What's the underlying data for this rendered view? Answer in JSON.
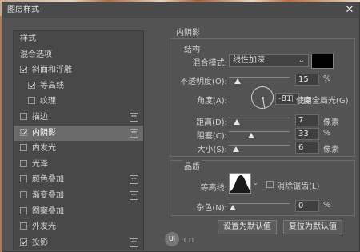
{
  "window": {
    "title": "图层样式",
    "close_glyph": "✕"
  },
  "left_list": {
    "header": "样式",
    "items": [
      {
        "label": "混合选项",
        "checkbox": false,
        "checked": false,
        "plus": false,
        "indent": false
      },
      {
        "label": "斜面和浮雕",
        "checkbox": true,
        "checked": true,
        "plus": false,
        "indent": false
      },
      {
        "label": "等高线",
        "checkbox": true,
        "checked": true,
        "plus": false,
        "indent": true
      },
      {
        "label": "纹理",
        "checkbox": true,
        "checked": false,
        "plus": false,
        "indent": true
      },
      {
        "label": "描边",
        "checkbox": true,
        "checked": false,
        "plus": true,
        "indent": false
      },
      {
        "label": "内阴影",
        "checkbox": true,
        "checked": true,
        "plus": true,
        "indent": false,
        "selected": true
      },
      {
        "label": "内发光",
        "checkbox": true,
        "checked": false,
        "plus": false,
        "indent": false
      },
      {
        "label": "光泽",
        "checkbox": true,
        "checked": false,
        "plus": false,
        "indent": false
      },
      {
        "label": "颜色叠加",
        "checkbox": true,
        "checked": false,
        "plus": true,
        "indent": false
      },
      {
        "label": "渐变叠加",
        "checkbox": true,
        "checked": false,
        "plus": true,
        "indent": false
      },
      {
        "label": "图案叠加",
        "checkbox": true,
        "checked": false,
        "plus": false,
        "indent": false
      },
      {
        "label": "外发光",
        "checkbox": true,
        "checked": false,
        "plus": false,
        "indent": false
      },
      {
        "label": "投影",
        "checkbox": true,
        "checked": true,
        "plus": true,
        "indent": false
      }
    ]
  },
  "panel": {
    "title": "内阴影",
    "structure": {
      "label": "结构",
      "blend_mode_label": "混合模式:",
      "blend_mode_value": "线性加深",
      "color": "#000000",
      "opacity_label": "不透明度(O):",
      "opacity_value": "15",
      "opacity_fraction": 0.15,
      "opacity_unit": "%",
      "angle_label": "角度(A):",
      "angle_value": "-81",
      "angle_unit": "度",
      "global_light_label": "使用全局光(G)",
      "global_light_checked": false,
      "distance_label": "距离(D):",
      "distance_value": "7",
      "distance_unit": "像素",
      "choke_label": "阻塞(C):",
      "choke_value": "33",
      "choke_unit": "%",
      "size_label": "大小(S):",
      "size_value": "6",
      "size_unit": "像素"
    },
    "quality": {
      "label": "品质",
      "contour_label": "等高线:",
      "antialias_label": "消除锯齿(L)",
      "antialias_checked": false,
      "noise_label": "杂色(N):",
      "noise_value": "0",
      "noise_unit": "%"
    },
    "buttons": {
      "set_default": "设置为默认值",
      "reset_default": "复位为默认值"
    }
  },
  "watermark": {
    "text": "·cn",
    "logo": "Ui"
  }
}
